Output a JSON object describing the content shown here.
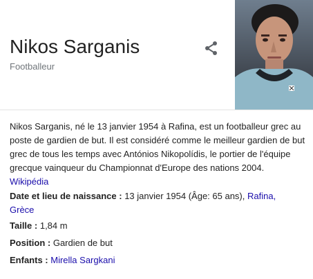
{
  "entity": {
    "name": "Nikos Sarganis",
    "type": "Footballeur",
    "share_icon": "share-icon",
    "photo_alt": "Nikos Sarganis photo"
  },
  "description": {
    "text": "Nikos Sarganis, né le 13 janvier 1954 à Rafina, est un footballeur grec au poste de gardien de but. Il est considéré comme le meilleur gardien de but grec de tous les temps avec Antónios Nikopolídis, le portier de l'équipe grecque vainqueur du Championnat d'Europe des nations 2004.",
    "source_label": "Wikipédia"
  },
  "facts": {
    "birth": {
      "label": "Date et lieu de naissance :",
      "value": "13 janvier 1954 (Âge: 65 ans),",
      "link1": "Rafina,",
      "link2": "Grèce"
    },
    "height": {
      "label": "Taille :",
      "value": "1,84 m"
    },
    "position": {
      "label": "Position :",
      "value": "Gardien de but"
    },
    "children": {
      "label": "Enfants :",
      "link": "Mirella Sargkani"
    }
  },
  "colors": {
    "link": "#1a0dab",
    "muted": "#70757a",
    "text": "#222222"
  }
}
